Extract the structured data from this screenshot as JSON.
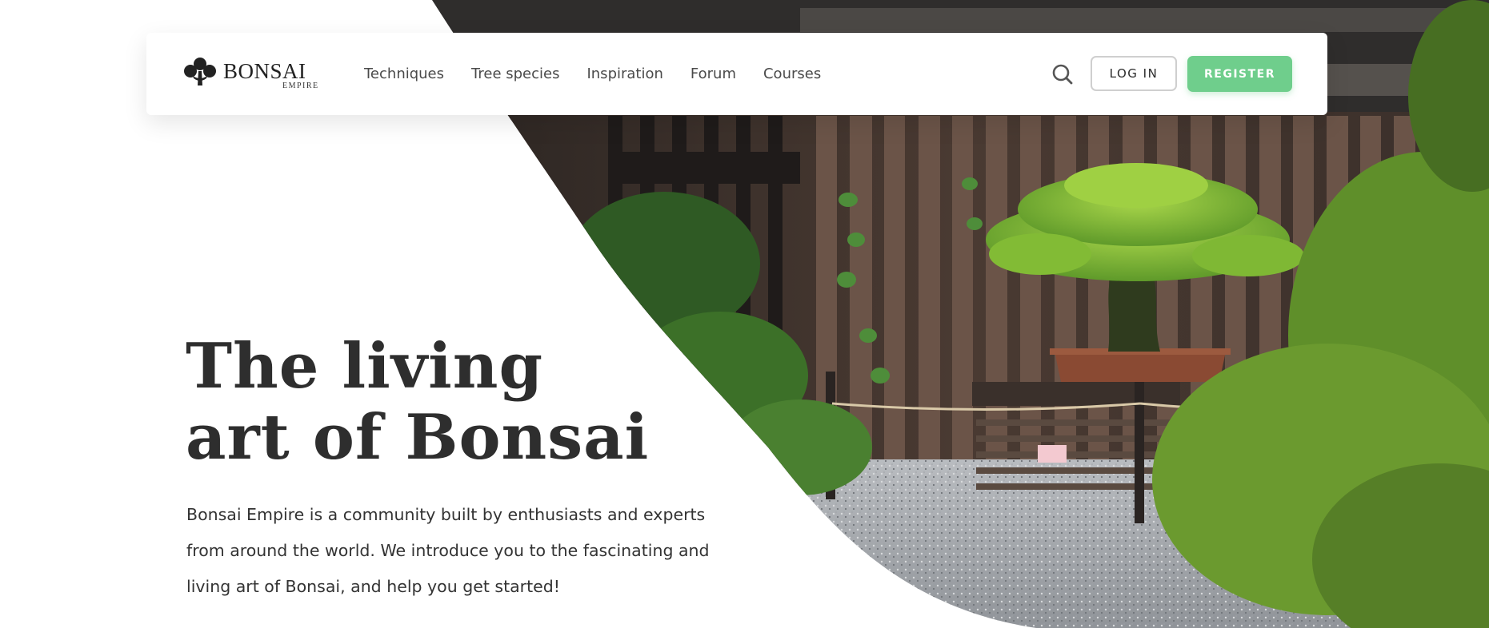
{
  "brand": {
    "name": "BONSAI",
    "sub": "EMPIRE",
    "logo_icon": "bonsai-tree-icon"
  },
  "nav": {
    "links": [
      {
        "label": "Techniques"
      },
      {
        "label": "Tree species"
      },
      {
        "label": "Inspiration"
      },
      {
        "label": "Forum"
      },
      {
        "label": "Courses"
      }
    ],
    "search_icon": "search-icon",
    "login_label": "LOG IN",
    "register_label": "REGISTER"
  },
  "hero": {
    "title_line1": "The living",
    "title_line2": "art of Bonsai",
    "description": "Bonsai Empire is a community built by enthusiasts and experts from around the world. We introduce you to the fascinating and living art of Bonsai, and help you get started!"
  },
  "colors": {
    "accent": "#6fce8c",
    "text": "#2e2e2e",
    "background": "#ffffff"
  }
}
